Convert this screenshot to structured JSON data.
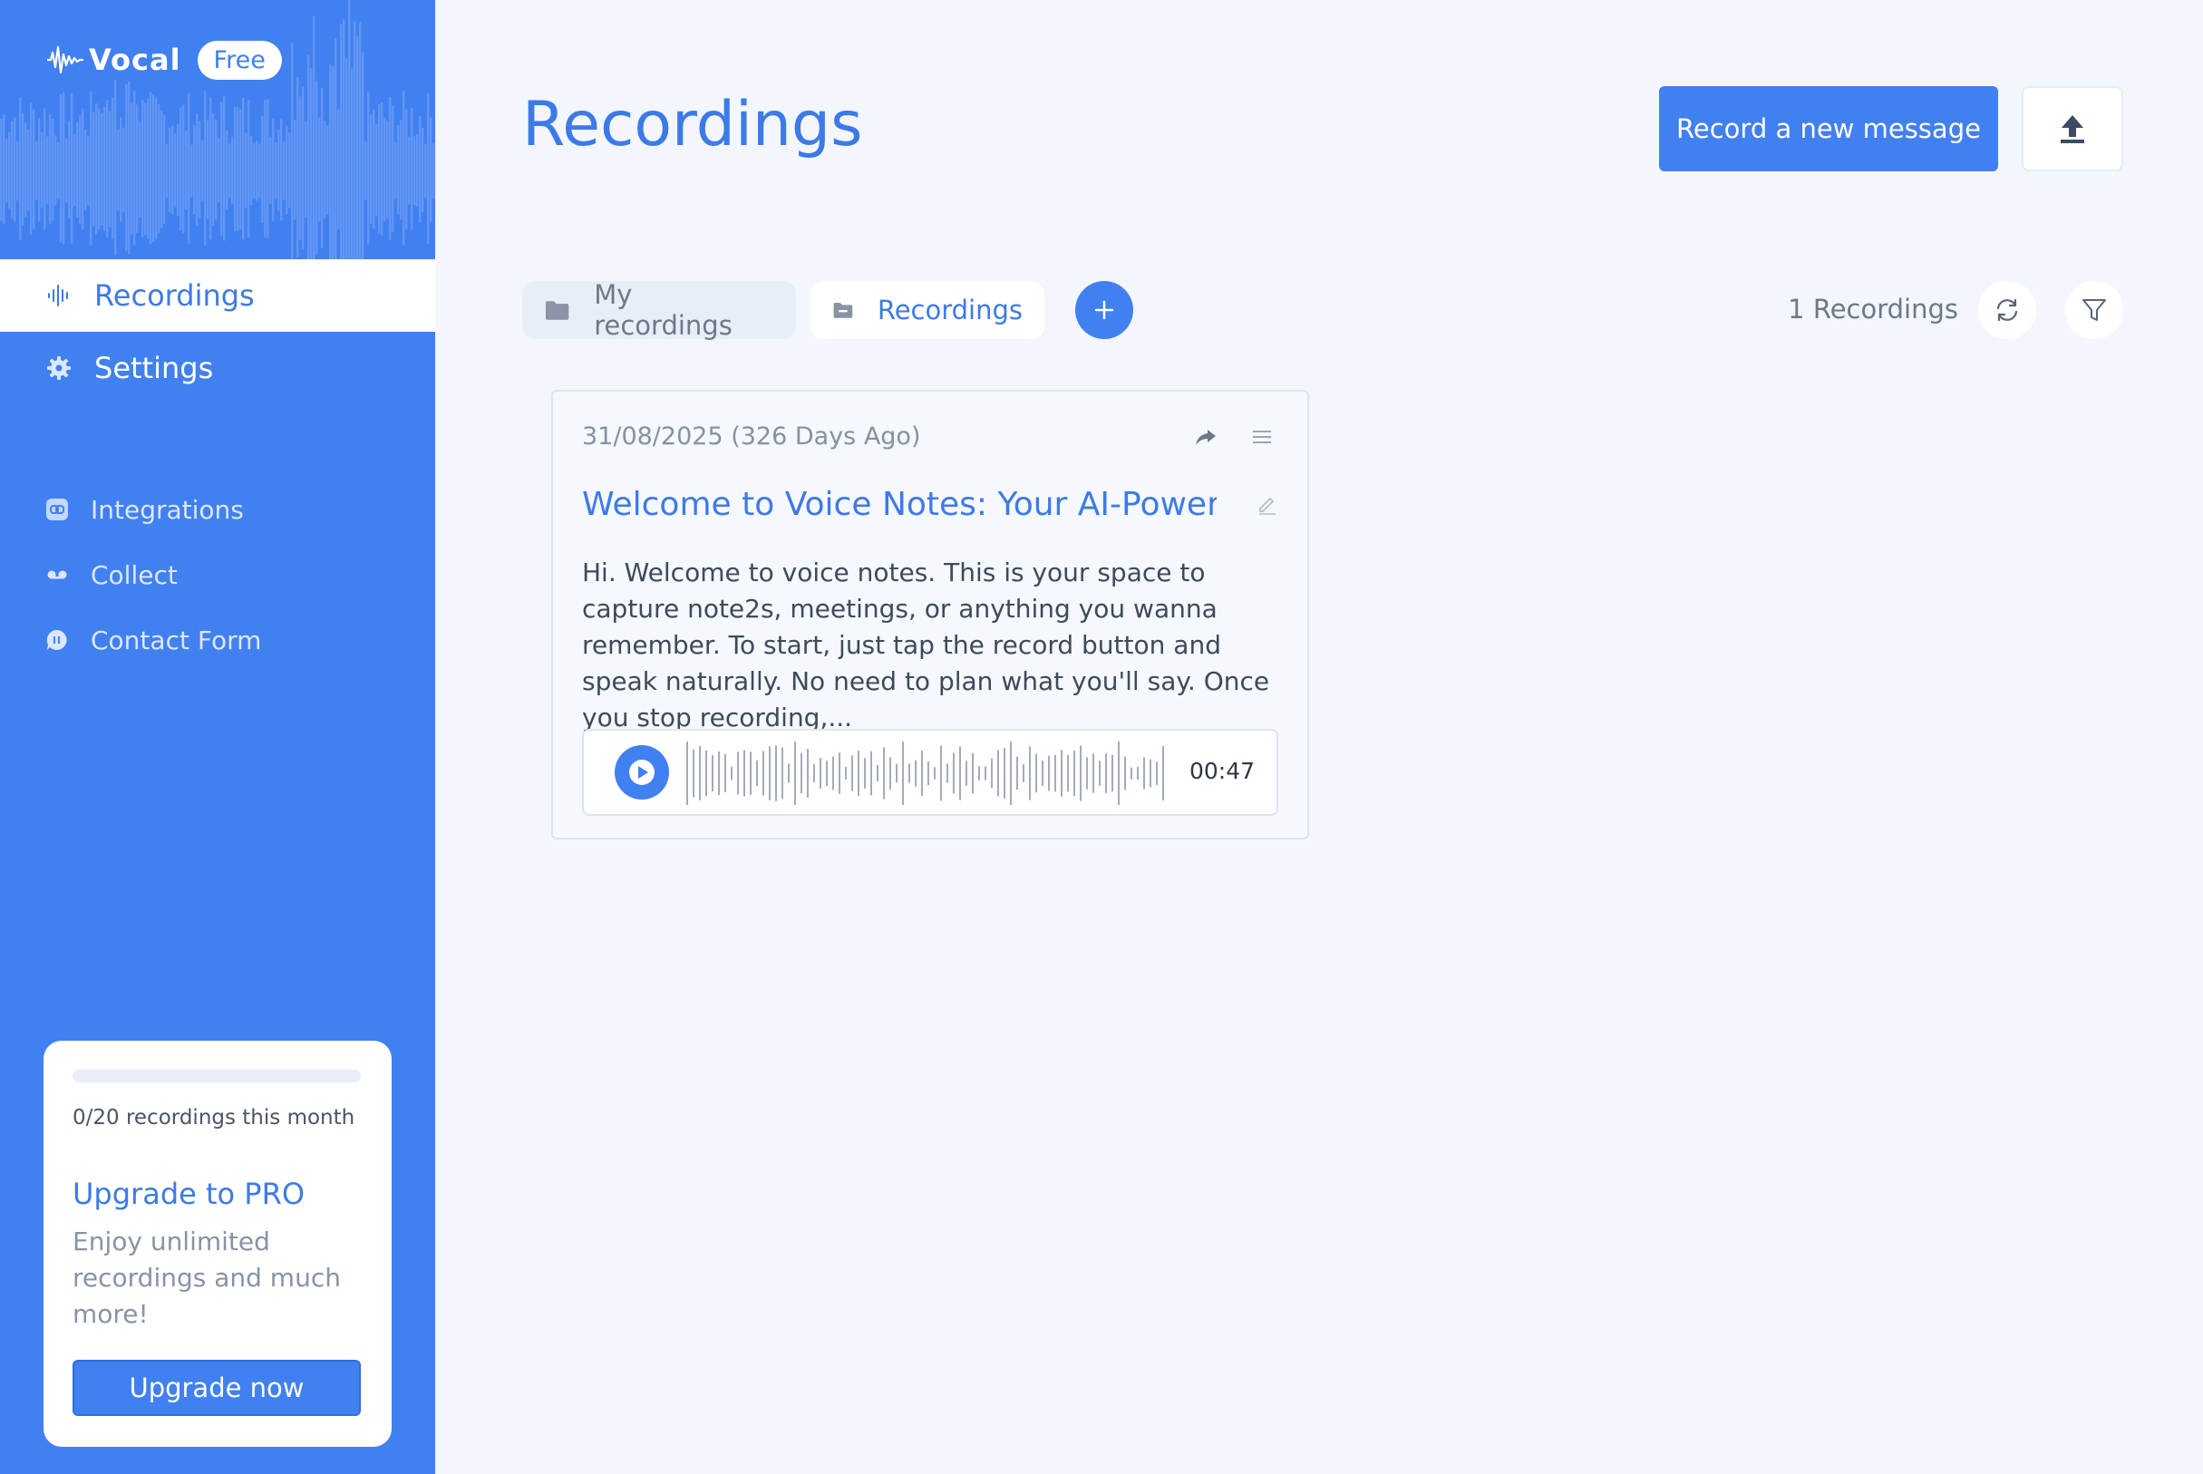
{
  "sidebar": {
    "brand": "Vocal",
    "plan_badge": "Free",
    "nav": [
      {
        "label": "Recordings",
        "icon": "waveform-icon",
        "active": true
      },
      {
        "label": "Settings",
        "icon": "gear-icon",
        "active": false
      }
    ],
    "sub_nav": [
      {
        "label": "Integrations",
        "icon": "link-icon"
      },
      {
        "label": "Collect",
        "icon": "voicemail-icon"
      },
      {
        "label": "Contact Form",
        "icon": "chat-icon"
      }
    ],
    "upgrade": {
      "usage_fraction": 0,
      "usage_text": "0/20 recordings this month",
      "title": "Upgrade to PRO",
      "description": "Enjoy unlimited recordings and much more!",
      "button": "Upgrade now"
    }
  },
  "header": {
    "title": "Recordings",
    "record_button": "Record a new message",
    "upload_icon": "upload-icon"
  },
  "folders": {
    "items": [
      {
        "label": "My recordings",
        "icon": "folder-icon",
        "active": false
      },
      {
        "label": "Recordings",
        "icon": "folder-inbox-icon",
        "active": true
      }
    ],
    "add_icon": "plus-icon",
    "count_label": "1 Recordings",
    "refresh_icon": "refresh-icon",
    "filter_icon": "filter-icon"
  },
  "recordings": [
    {
      "date": "31/08/2025 (326 Days Ago)",
      "title": "Welcome to Voice Notes: Your AI-Power...",
      "transcript": "Hi. Welcome to voice notes. This is your space to capture note2s, meetings, or anything you wanna remember. To start, just tap the record button and speak naturally. No need to plan what you'll say. Once you stop recording,...",
      "duration": "00:47"
    }
  ],
  "colors": {
    "accent": "#4180f0",
    "title_blue": "#3d7ae8",
    "background": "#f3f7fd"
  }
}
